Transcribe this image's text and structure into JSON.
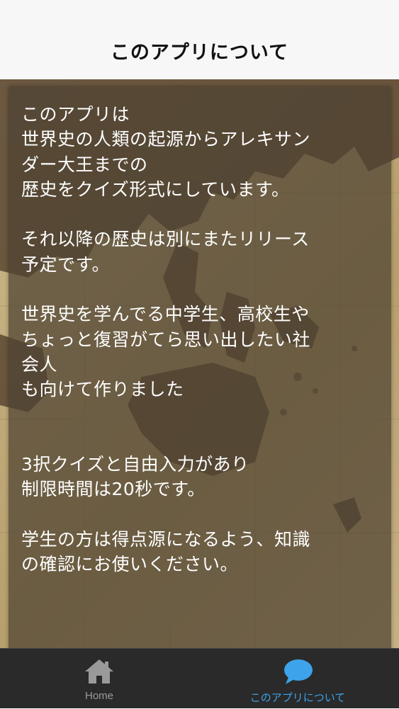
{
  "header": {
    "title": "このアプリについて"
  },
  "content": {
    "about_text": "このアプリは\n世界史の人類の起源からアレキサン\nダー大王までの\n歴史をクイズ形式にしています。\n\nそれ以降の歴史は別にまたリリース\n予定です。\n\n世界史を学んでる中学生、高校生や\nちょっと復習がてら思い出したい社\n会人\nも向けて作りました\n\n\n3択クイズと自由入力があり\n制限時間は20秒です。\n\n学生の方は得点源になるよう、知識\nの確認にお使いください。"
  },
  "tab_bar": {
    "home": {
      "label": "Home",
      "icon": "home-icon"
    },
    "about": {
      "label": "このアプリについて",
      "icon": "speech-bubble-icon"
    }
  },
  "colors": {
    "nav_background": "#f7f7f7",
    "tab_bar_background": "#2a2a2a",
    "tab_inactive": "#9a9a9a",
    "tab_active": "#3da3ea",
    "panel_overlay": "rgba(78,66,50,0.72)",
    "text": "#ffffff"
  }
}
